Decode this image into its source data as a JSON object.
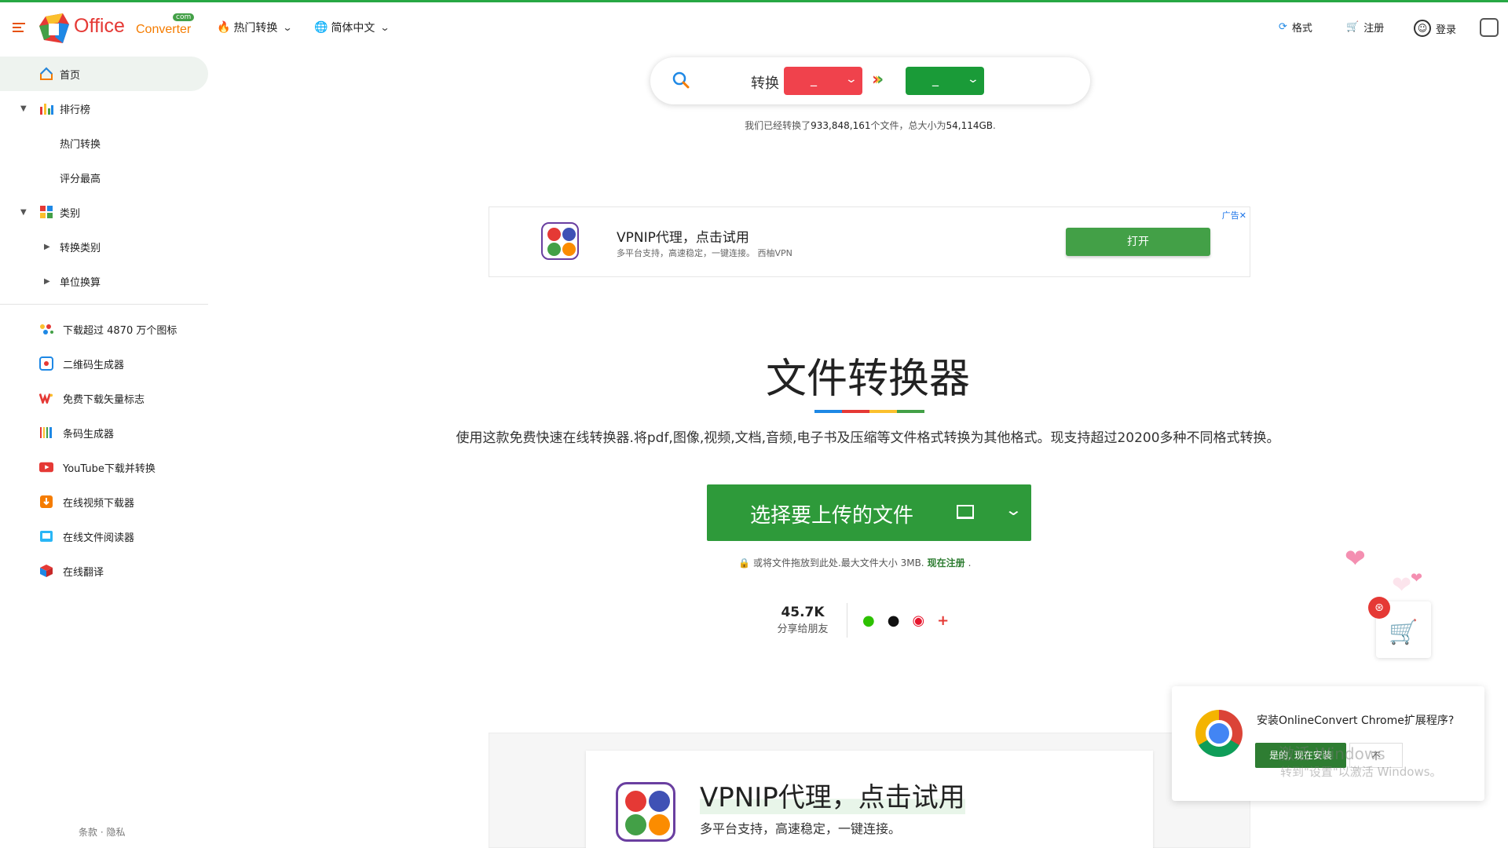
{
  "header": {
    "logo_text": "Office",
    "logo_text2": "Converter",
    "logo_com": "com",
    "nav_hot": "热门转换",
    "nav_lang": "简体中文",
    "format": "格式",
    "register": "注册",
    "login": "登录"
  },
  "sidebar": {
    "items": [
      {
        "label": "首页"
      },
      {
        "label": "排行榜"
      },
      {
        "label": "热门转换"
      },
      {
        "label": "评分最高"
      },
      {
        "label": "类别"
      },
      {
        "label": "转换类别"
      },
      {
        "label": "单位换算"
      }
    ],
    "tools": [
      {
        "label": "下载超过 4870 万个图标"
      },
      {
        "label": "二维码生成器"
      },
      {
        "label": "免费下载矢量标志"
      },
      {
        "label": "条码生成器"
      },
      {
        "label": "YouTube下载并转换"
      },
      {
        "label": "在线视频下载器"
      },
      {
        "label": "在线文件阅读器"
      },
      {
        "label": "在线翻译"
      }
    ],
    "footer": "条款 · 隐私"
  },
  "search": {
    "convert_label": "转换",
    "from_value": "_",
    "to_value": "_",
    "stats_prefix": "我们已经转换了",
    "stats_files": "933,848,161",
    "stats_mid": "个文件，总大小为",
    "stats_size": "54,114GB",
    "stats_suffix": "."
  },
  "ad_top": {
    "title": "VPNIP代理，点击试用",
    "subtitle": "多平台支持，高速稳定，一键连接。 西柚VPN",
    "button": "打开",
    "badge": "广告✕"
  },
  "main": {
    "title": "文件转换器",
    "description": "使用这款免费快速在线转换器.将pdf,图像,视频,文档,音频,电子书及压缩等文件格式转换为其他格式。现支持超过20200多种不同格式转换。",
    "upload_label": "选择要上传的文件",
    "note_text": "或将文件拖放到此处.最大文件大小 3MB.",
    "note_register": "现在注册",
    "note_end": ".",
    "share_count": "45.7K",
    "share_text": "分享给朋友"
  },
  "ad_bottom": {
    "title": "VPNIP代理，点击试用",
    "subtitle": "多平台支持，高速稳定，一键连接。"
  },
  "chrome_prompt": {
    "question": "安装OnlineConvert Chrome扩展程序?",
    "yes": "是的, 现在安装",
    "no": "不"
  },
  "watermark": {
    "line1": "激活 Windows",
    "line2": "转到\"设置\"以激活 Windows。"
  },
  "colors": {
    "accent_green": "#2e9a3a",
    "from_red": "#f0424c",
    "to_green": "#1a9b38"
  }
}
